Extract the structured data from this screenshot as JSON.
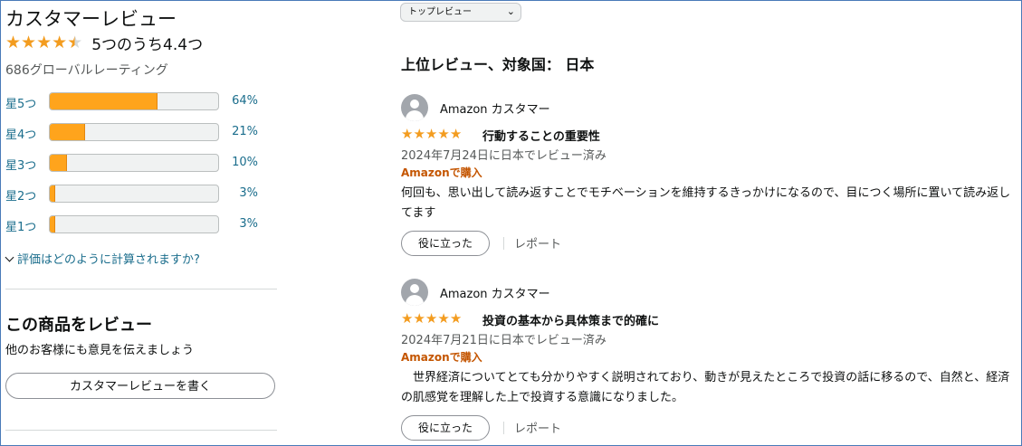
{
  "summary": {
    "title": "カスタマーレビュー",
    "rating_text": "5つのうち4.4つ",
    "rating_value": 4.4,
    "global_ratings": "686グローバルレーティング",
    "histogram": [
      {
        "label": "星5つ",
        "percent": 64,
        "percent_text": "64%"
      },
      {
        "label": "星4つ",
        "percent": 21,
        "percent_text": "21%"
      },
      {
        "label": "星3つ",
        "percent": 10,
        "percent_text": "10%"
      },
      {
        "label": "星2つ",
        "percent": 3,
        "percent_text": "3%"
      },
      {
        "label": "星1つ",
        "percent": 3,
        "percent_text": "3%"
      }
    ],
    "how_calculated": "評価はどのように計算されますか?",
    "star_color": "#f39c1f",
    "bar_color": "#ffa41c"
  },
  "write_review": {
    "heading": "この商品をレビュー",
    "subtext": "他のお客様にも意見を伝えましょう",
    "button": "カスタマーレビューを書く"
  },
  "sort": {
    "selected": "トップレビュー"
  },
  "reviews_section": {
    "title": "上位レビュー、対象国： 日本"
  },
  "reviews": [
    {
      "author": "Amazon カスタマー",
      "stars": 5,
      "title": "行動することの重要性",
      "date": "2024年7月24日に日本でレビュー済み",
      "verified": "Amazonで購入",
      "body": "何回も、思い出して読み返すことでモチベーションを維持するきっかけになるので、目につく場所に置いて読み返してます",
      "helpful": "役に立った",
      "report": "レポート"
    },
    {
      "author": "Amazon カスタマー",
      "stars": 5,
      "title": "投資の基本から具体策まで的確に",
      "date": "2024年7月21日に日本でレビュー済み",
      "verified": "Amazonで購入",
      "body": "　世界経済についてとても分かりやすく説明されており、動きが見えたところで投資の話に移るので、自然と、経済の肌感覚を理解した上で投資する意識になりました。",
      "helpful": "役に立った",
      "report": "レポート"
    }
  ]
}
